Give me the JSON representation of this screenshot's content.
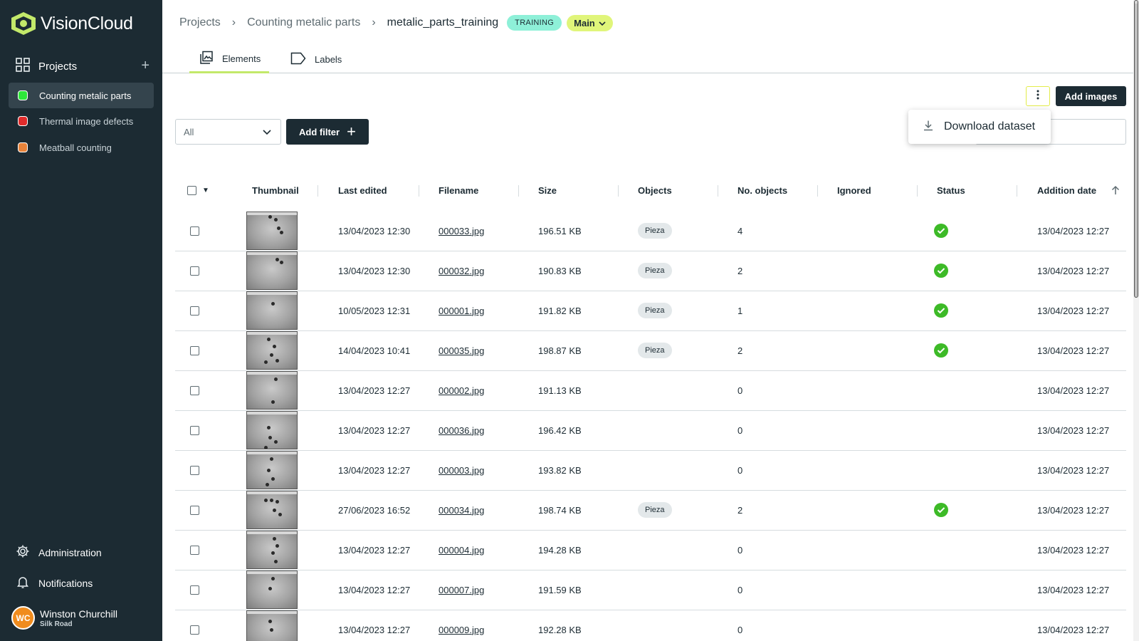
{
  "app": {
    "name": "VisionCloud"
  },
  "colors": {
    "sidebar_bg": "#1c2b33",
    "accent_green": "#c3e96a",
    "status_ok": "#3dba27"
  },
  "sidebar": {
    "projects_label": "Projects",
    "add_icon": "plus-icon",
    "projects": [
      {
        "label": "Counting metalic parts",
        "color": "#2ee83a",
        "active": true
      },
      {
        "label": "Thermal image defects",
        "color": "#e02b2b",
        "active": false
      },
      {
        "label": "Meatball counting",
        "color": "#e8833a",
        "active": false
      }
    ],
    "administration_label": "Administration",
    "notifications_label": "Notifications",
    "user": {
      "initials": "WC",
      "name": "Winston Churchill",
      "subtitle": "Silk Road"
    }
  },
  "breadcrumb": {
    "items": [
      "Projects",
      "Counting metalic parts",
      "metalic_parts_training"
    ],
    "badge_training": "TRAINING",
    "badge_main": "Main"
  },
  "tabs": [
    {
      "label": "Elements",
      "active": true,
      "icon": "images-icon"
    },
    {
      "label": "Labels",
      "active": false,
      "icon": "label-icon"
    }
  ],
  "toolbar": {
    "add_images_label": "Add images",
    "filter_value": "All",
    "add_filter_label": "Add filter",
    "menu_download_label": "Download dataset"
  },
  "table": {
    "columns": [
      "Thumbnail",
      "Last edited",
      "Filename",
      "Size",
      "Objects",
      "No. objects",
      "Ignored",
      "Status",
      "Addition date"
    ],
    "rows": [
      {
        "last_edited": "13/04/2023 12:30",
        "filename": "000033.jpg",
        "size": "196.51 KB",
        "objects": "Pieza",
        "count": "4",
        "status_ok": true,
        "added": "13/04/2023 12:27"
      },
      {
        "last_edited": "13/04/2023 12:30",
        "filename": "000032.jpg",
        "size": "190.83 KB",
        "objects": "Pieza",
        "count": "2",
        "status_ok": true,
        "added": "13/04/2023 12:27"
      },
      {
        "last_edited": "10/05/2023 12:31",
        "filename": "000001.jpg",
        "size": "191.82 KB",
        "objects": "Pieza",
        "count": "1",
        "status_ok": true,
        "added": "13/04/2023 12:27"
      },
      {
        "last_edited": "14/04/2023 10:41",
        "filename": "000035.jpg",
        "size": "198.87 KB",
        "objects": "Pieza",
        "count": "2",
        "status_ok": true,
        "added": "13/04/2023 12:27"
      },
      {
        "last_edited": "13/04/2023 12:27",
        "filename": "000002.jpg",
        "size": "191.13 KB",
        "objects": "",
        "count": "0",
        "status_ok": false,
        "added": "13/04/2023 12:27"
      },
      {
        "last_edited": "13/04/2023 12:27",
        "filename": "000036.jpg",
        "size": "196.42 KB",
        "objects": "",
        "count": "0",
        "status_ok": false,
        "added": "13/04/2023 12:27"
      },
      {
        "last_edited": "13/04/2023 12:27",
        "filename": "000003.jpg",
        "size": "193.82 KB",
        "objects": "",
        "count": "0",
        "status_ok": false,
        "added": "13/04/2023 12:27"
      },
      {
        "last_edited": "27/06/2023 16:52",
        "filename": "000034.jpg",
        "size": "198.74 KB",
        "objects": "Pieza",
        "count": "2",
        "status_ok": true,
        "added": "13/04/2023 12:27"
      },
      {
        "last_edited": "13/04/2023 12:27",
        "filename": "000004.jpg",
        "size": "194.28 KB",
        "objects": "",
        "count": "0",
        "status_ok": false,
        "added": "13/04/2023 12:27"
      },
      {
        "last_edited": "13/04/2023 12:27",
        "filename": "000007.jpg",
        "size": "191.59 KB",
        "objects": "",
        "count": "0",
        "status_ok": false,
        "added": "13/04/2023 12:27"
      },
      {
        "last_edited": "13/04/2023 12:27",
        "filename": "000009.jpg",
        "size": "192.28 KB",
        "objects": "",
        "count": "0",
        "status_ok": false,
        "added": "13/04/2023 12:27"
      }
    ]
  }
}
